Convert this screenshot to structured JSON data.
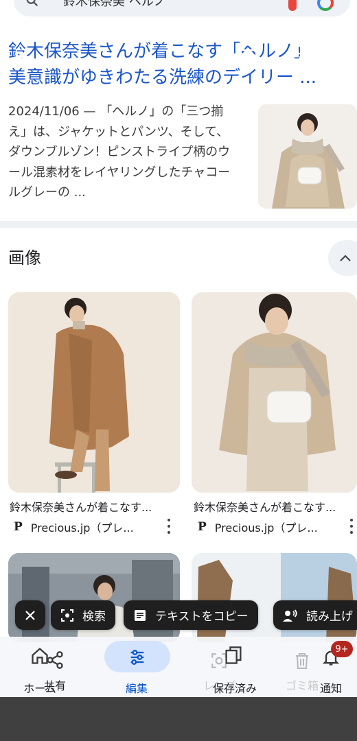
{
  "search": {
    "query": "鈴木保奈美 ヘルノ"
  },
  "result": {
    "title_line1": "鈴木保奈美さんが着こなす「ヘルノ」",
    "title_line2": "美意識がゆきわたる洗練のデイリー ...",
    "snippet": "2024/11/06 — 「ヘルノ」の「三つ揃え」は、ジャケットとパンツ、そして、ダウンブルゾン！ピンストライプ柄のウール混素材をレイヤリングしたチャコールグレーの ..."
  },
  "images_section": {
    "header": "画像",
    "cards": [
      {
        "caption": "鈴木保奈美さんが着こなす...",
        "source": "Precious.jp（プレ..."
      },
      {
        "caption": "鈴木保奈美さんが着こなす...",
        "source": "Precious.jp（プレ..."
      }
    ]
  },
  "chips": [
    {
      "label": "",
      "icon": "close-icon"
    },
    {
      "label": "検索",
      "icon": "lens-search-icon"
    },
    {
      "label": "テキストをコピー",
      "icon": "text-copy-icon"
    },
    {
      "label": "読み上げ",
      "icon": "read-aloud-icon"
    }
  ],
  "bottom_bar": {
    "home": "ホーム",
    "share": "共有",
    "edit": "編集",
    "lens": "レンズ",
    "saved": "保存済み",
    "trash": "ゴミ箱",
    "notifications": "通知",
    "badge": "9+"
  },
  "colors": {
    "link": "#1a56c9",
    "active": "#0b57d0",
    "chip_bg": "#1f1f1f",
    "badge": "#b3261e"
  }
}
